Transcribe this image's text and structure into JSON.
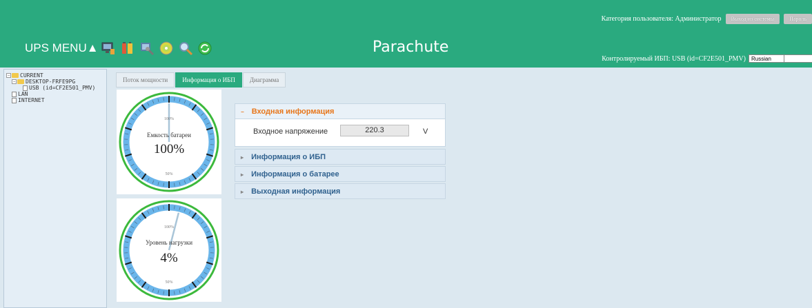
{
  "header": {
    "user_category": "Категория пользователя: Администратор",
    "logout_label": "Выход из системы",
    "password_label": "Пароль",
    "menu_title": "UPS MENU▲",
    "app_title": "Parachute",
    "monitored_ups": "Контролируемый ИБП: USB (id=CF2E501_PMV)",
    "language": "Russian",
    "toolbar_icons": [
      "monitor-icon",
      "battery-icon",
      "tools-icon",
      "disc-icon",
      "search-icon",
      "refresh-icon"
    ]
  },
  "sidebar": {
    "tree": [
      {
        "label": "CURRENT",
        "level": 0
      },
      {
        "label": "DESKTOP-FRFE9PG",
        "level": 1
      },
      {
        "label": "USB (id=CF2E501_PMV)",
        "level": 2
      },
      {
        "label": "LAN",
        "level": 0
      },
      {
        "label": "INTERNET",
        "level": 0
      }
    ]
  },
  "tabs": [
    "Поток мощности",
    "Информация о ИБП",
    "Диаграмма"
  ],
  "gauges": {
    "battery": {
      "label": "Емкость батареи",
      "value_text": "100%",
      "value": 100,
      "max_tick": "100%",
      "mid_tick": "50%"
    },
    "load": {
      "label": "Уровень нагрузки",
      "value_text": "4%",
      "value": 4,
      "max_tick": "100%",
      "mid_tick": "50%"
    }
  },
  "panel": {
    "sections": [
      "Входная информация",
      "Информация о ИБП",
      "Информация о батарее",
      "Выходная информация"
    ],
    "input_voltage_label": "Входное напряжение",
    "input_voltage_value": "220.3",
    "input_voltage_unit": "V"
  },
  "colors": {
    "accent": "#2aaa7f",
    "open_section": "#e8761a",
    "section_text": "#31628f"
  }
}
